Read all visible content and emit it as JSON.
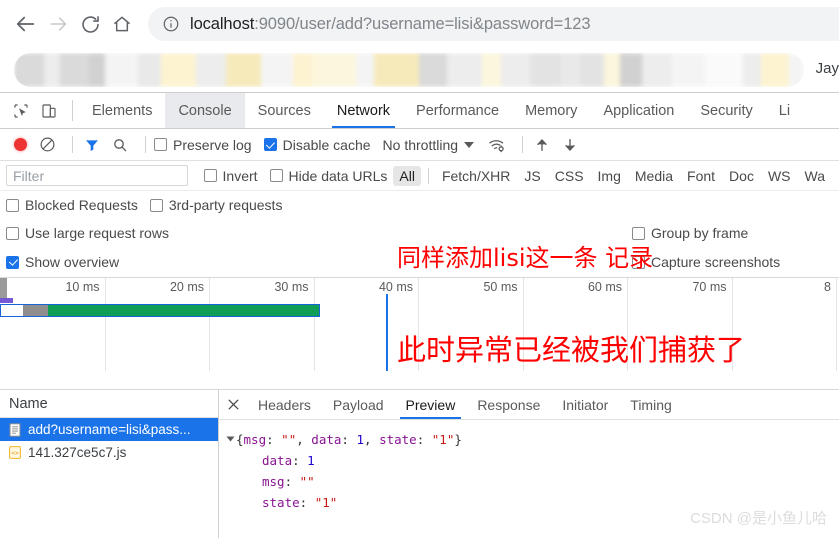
{
  "browser": {
    "nav": {
      "back_icon": "arrow-left-icon",
      "forward_icon": "arrow-right-icon",
      "reload_icon": "reload-icon",
      "home_icon": "home-icon"
    },
    "omnibox": {
      "info_icon": "info-circle-icon",
      "host": "localhost",
      "rest": ":9090/user/add?username=lisi&password=123",
      "full_url": "localhost:9090/user/add?username=lisi&password=123"
    },
    "bookmark_bar": {
      "obscured": true,
      "profile_name": "Jay"
    }
  },
  "devtools": {
    "tools": {
      "inspect_icon": "inspect-element-icon",
      "device_icon": "device-toolbar-icon"
    },
    "tabs": [
      {
        "label": "Elements",
        "state": "normal"
      },
      {
        "label": "Console",
        "state": "hovered"
      },
      {
        "label": "Sources",
        "state": "normal"
      },
      {
        "label": "Network",
        "state": "active"
      },
      {
        "label": "Performance",
        "state": "normal"
      },
      {
        "label": "Memory",
        "state": "normal"
      },
      {
        "label": "Application",
        "state": "normal"
      },
      {
        "label": "Security",
        "state": "normal"
      },
      {
        "label": "Li",
        "state": "clipped"
      }
    ],
    "network_toolbar": {
      "record_icon": "record-circle-icon",
      "clear_icon": "clear-prohibited-icon",
      "filter_icon": "filter-funnel-icon",
      "search_icon": "search-icon",
      "preserve_log_label": "Preserve log",
      "preserve_log_checked": false,
      "disable_cache_label": "Disable cache",
      "disable_cache_checked": true,
      "throttling_value": "No throttling",
      "throttling_caret_icon": "chevron-down-icon",
      "wifi_settings_icon": "wifi-gear-icon",
      "import_icon": "upload-arrow-icon",
      "export_icon": "download-arrow-icon"
    },
    "filter_bar": {
      "filter_placeholder": "Filter",
      "filter_value": "",
      "invert_label": "Invert",
      "invert_checked": false,
      "hide_data_urls_label": "Hide data URLs",
      "hide_data_urls_checked": false,
      "types": [
        {
          "label": "All",
          "selected": true
        },
        {
          "label": "Fetch/XHR",
          "selected": false
        },
        {
          "label": "JS",
          "selected": false
        },
        {
          "label": "CSS",
          "selected": false
        },
        {
          "label": "Img",
          "selected": false
        },
        {
          "label": "Media",
          "selected": false
        },
        {
          "label": "Font",
          "selected": false
        },
        {
          "label": "Doc",
          "selected": false
        },
        {
          "label": "WS",
          "selected": false
        },
        {
          "label": "Wa",
          "selected": false
        }
      ],
      "blocked_requests_label": "Blocked Requests",
      "blocked_requests_checked": false,
      "third_party_label": "3rd-party requests",
      "third_party_checked": false
    },
    "options": {
      "large_rows_label": "Use large request rows",
      "large_rows_checked": false,
      "group_by_frame_label": "Group by frame",
      "group_by_frame_checked": false,
      "show_overview_label": "Show overview",
      "show_overview_checked": true,
      "capture_screenshots_label": "Capture screenshots",
      "capture_screenshots_checked": false
    },
    "overview": {
      "ticks": [
        "10 ms",
        "20 ms",
        "30 ms",
        "40 ms",
        "50 ms",
        "60 ms",
        "70 ms",
        "8"
      ],
      "marker_label": "40 ms"
    },
    "request_list": {
      "column_header": "Name",
      "rows": [
        {
          "name": "add?username=lisi&pass...",
          "icon": "document-icon",
          "selected": true
        },
        {
          "name": "141.327ce5c7.js",
          "icon": "js-file-icon",
          "selected": false
        }
      ]
    },
    "detail_panel": {
      "close_icon": "close-x-icon",
      "tabs": [
        {
          "label": "Headers",
          "active": false
        },
        {
          "label": "Payload",
          "active": false
        },
        {
          "label": "Preview",
          "active": true
        },
        {
          "label": "Response",
          "active": false
        },
        {
          "label": "Initiator",
          "active": false
        },
        {
          "label": "Timing",
          "active": false
        }
      ],
      "preview": {
        "summary_parts": [
          {
            "text": "{",
            "kind": "pun"
          },
          {
            "text": "msg",
            "kind": "prop"
          },
          {
            "text": ": ",
            "kind": "pun"
          },
          {
            "text": "\"\"",
            "kind": "str"
          },
          {
            "text": ", ",
            "kind": "pun"
          },
          {
            "text": "data",
            "kind": "prop"
          },
          {
            "text": ": ",
            "kind": "pun"
          },
          {
            "text": "1",
            "kind": "num"
          },
          {
            "text": ", ",
            "kind": "pun"
          },
          {
            "text": "state",
            "kind": "prop"
          },
          {
            "text": ": ",
            "kind": "pun"
          },
          {
            "text": "\"1\"",
            "kind": "str"
          },
          {
            "text": "}",
            "kind": "pun"
          }
        ],
        "entries": [
          {
            "key": "data",
            "value": "1",
            "kind": "num"
          },
          {
            "key": "msg",
            "value": "\"\"",
            "kind": "str"
          },
          {
            "key": "state",
            "value": "\"1\"",
            "kind": "str"
          }
        ]
      }
    }
  },
  "annotations": {
    "note_1": "同样添加lisi这一条 记录",
    "note_2": "此时异常已经被我们捕获了",
    "watermark": "CSDN @是小鱼儿哈"
  },
  "colors": {
    "accent_blue": "#1a73e8",
    "annotation_red": "#ff0000",
    "timeline_green": "#0f9d58",
    "timeline_purple": "#7558d6",
    "json_prop": "#881391",
    "json_number": "#1c00cf",
    "json_string": "#c41a16"
  }
}
